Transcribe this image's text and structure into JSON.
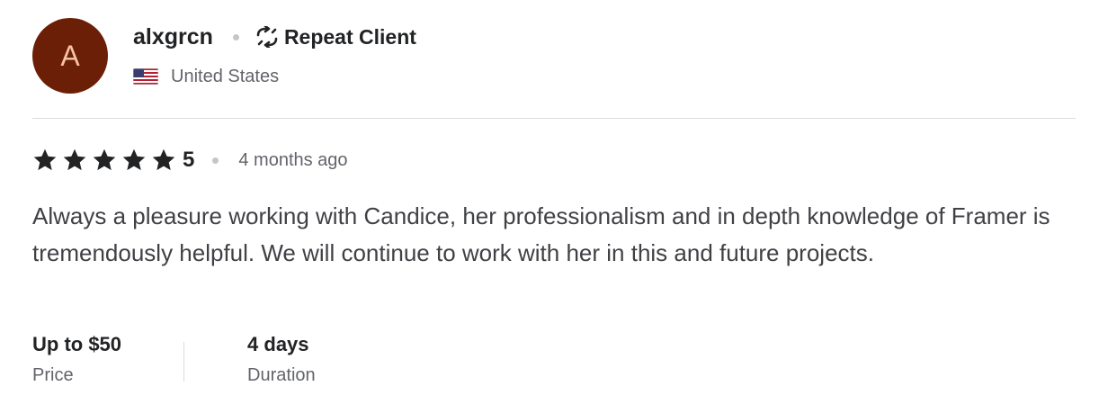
{
  "reviewer": {
    "avatar_initial": "A",
    "avatar_color": "#6b1f06",
    "username": "alxgrcn",
    "badge_icon": "repeat-icon",
    "badge_label": "Repeat Client",
    "country_flag": "us-flag-icon",
    "country": "United States"
  },
  "rating": {
    "stars": 5,
    "value": "5",
    "time_ago": "4 months ago"
  },
  "review": {
    "text": "Always a pleasure working with Candice, her professionalism and in depth knowledge of Framer is tremendously helpful. We will continue to work with her in this and future projects."
  },
  "meta": {
    "price_value": "Up to $50",
    "price_label": "Price",
    "duration_value": "4 days",
    "duration_label": "Duration"
  }
}
